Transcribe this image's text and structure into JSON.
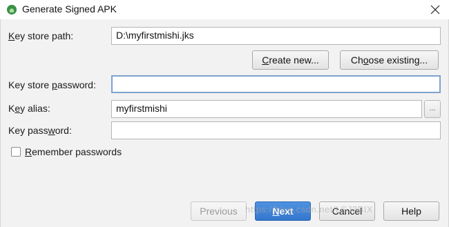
{
  "window": {
    "title": "Generate Signed APK"
  },
  "form": {
    "key_store_path": {
      "label": "Key store path:",
      "value": "D:\\myfirstmishi.jks"
    },
    "create_new_label": "Create new...",
    "choose_existing_label": "Choose existing...",
    "key_store_password": {
      "label": "Key store password:",
      "value": ""
    },
    "key_alias": {
      "label": "Key alias:",
      "value": "myfirstmishi",
      "browse_label": "..."
    },
    "key_password": {
      "label": "Key password:",
      "value": ""
    },
    "remember_passwords": {
      "label": "Remember passwords",
      "checked": false
    }
  },
  "footer": {
    "previous_label": "Previous",
    "next_label": "Next",
    "cancel_label": "Cancel",
    "help_label": "Help"
  },
  "watermark": "https://blog.csdn.net/LSJ3BIX",
  "colors": {
    "primary_button": "#3a7fd5",
    "focus_border": "#7da2ce",
    "app_icon": "#3ddc84"
  }
}
